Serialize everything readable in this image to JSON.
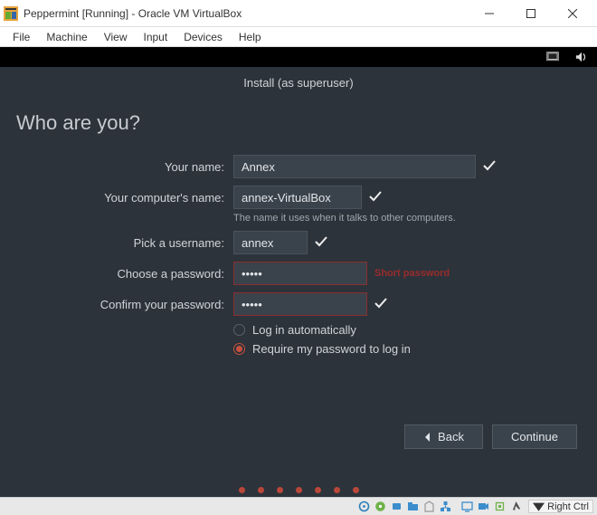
{
  "window": {
    "title": "Peppermint [Running] - Oracle VM VirtualBox"
  },
  "menubar": {
    "items": [
      "File",
      "Machine",
      "View",
      "Input",
      "Devices",
      "Help"
    ]
  },
  "installer": {
    "subtitle": "Install (as superuser)",
    "heading": "Who are you?",
    "labels": {
      "your_name": "Your name:",
      "computer_name": "Your computer's name:",
      "computer_hint": "The name it uses when it talks to other computers.",
      "pick_username": "Pick a username:",
      "choose_password": "Choose a password:",
      "confirm_password": "Confirm your password:",
      "auto_login": "Log in automatically",
      "require_password": "Require my password to log in"
    },
    "values": {
      "your_name": "Annex",
      "computer_name": "annex-VirtualBox",
      "username": "annex",
      "password": "•••••",
      "confirm_password": "•••••"
    },
    "password_warning": "Short password",
    "login_option": "require_password",
    "buttons": {
      "back": "Back",
      "continue": "Continue"
    },
    "pager_dots": 7
  },
  "statusbar": {
    "host_key": "Right Ctrl"
  }
}
